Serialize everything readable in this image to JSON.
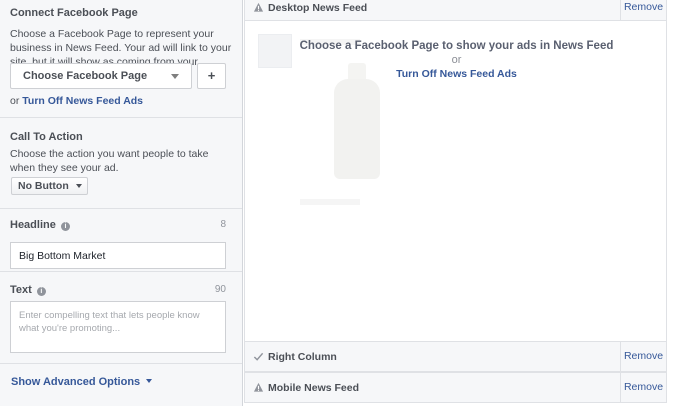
{
  "left_panel": {
    "connect_page": {
      "title": "Connect Facebook Page",
      "description": "Choose a Facebook Page to represent your business in News Feed. Your ad will link to your site, but it will show as coming from your Facebook Page.",
      "select_label": "Choose Facebook Page",
      "plus_label": "+",
      "or_prefix": "or",
      "turn_off_link": "Turn Off News Feed Ads"
    },
    "call_to_action": {
      "title": "Call To Action",
      "description": "Choose the action you want people to take when they see your ad.",
      "button_value": "No Button"
    },
    "headline": {
      "label": "Headline",
      "count": "8",
      "value": "Big Bottom Market"
    },
    "text": {
      "label": "Text",
      "count": "90",
      "placeholder": "Enter compelling text that lets people know what you're promoting..."
    },
    "advanced_options_label": "Show Advanced Options"
  },
  "right_panel": {
    "desktop": {
      "label": "Desktop News Feed",
      "icon": "warning-icon",
      "remove_label": "Remove",
      "message": "Choose a Facebook Page to show your ads in News Feed",
      "or_text": "or",
      "turn_off_link": "Turn Off News Feed Ads"
    },
    "right_column": {
      "label": "Right Column",
      "icon": "checkmark-icon",
      "remove_label": "Remove"
    },
    "mobile": {
      "label": "Mobile News Feed",
      "icon": "warning-icon",
      "remove_label": "Remove"
    }
  },
  "colors": {
    "link": "#365899",
    "panel_bg": "#f6f7f9",
    "border": "#dfe1e5"
  }
}
